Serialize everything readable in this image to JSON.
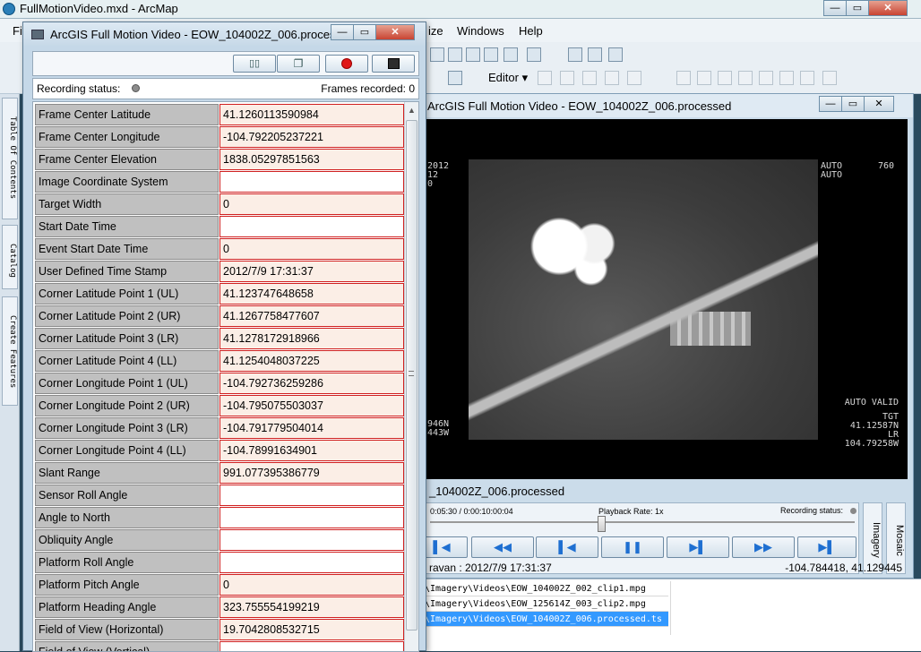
{
  "arcmap": {
    "title": "FullMotionVideo.mxd - ArcMap",
    "menu_partial": [
      "Fil",
      "ize",
      "Windows",
      "Help"
    ],
    "editor_label": "Editor",
    "left_tabs": [
      "Table Of Contents",
      "Catalog",
      "Create Features"
    ]
  },
  "video_window": {
    "title": "EOW_104002Z_006.processed",
    "title_visible": "ArcGIS Full Motion Video - EOW_104002Z_006.processed",
    "hud": {
      "top_left": [
        "2012",
        "12",
        "0"
      ],
      "top_tags": [
        "AUTO",
        "AUTO"
      ],
      "top_right_num": "760",
      "bottom_right": [
        "AUTO VALID",
        "TGT",
        "41.12587N",
        "LR 104.79258W"
      ],
      "bottom_left": [
        "946N",
        "443W"
      ]
    },
    "clip_title": "_104002Z_006.processed",
    "time": "0:05:30 / 0:00:10:00:04",
    "playback_rate": "Playback Rate: 1x",
    "recording_status": "Recording status:",
    "side_tabs": [
      "Imagery",
      "Mosaic"
    ],
    "status_left": "ravan : 2012/7/9 17:31:37",
    "status_right": "-104.784418, 41.129445",
    "files": [
      "\\Imagery\\Videos\\EOW_104002Z_002_clip1.mpg",
      "\\Imagery\\Videos\\EOW_125614Z_003_clip2.mpg",
      "\\Imagery\\Videos\\EOW_104002Z_006.processed.ts"
    ]
  },
  "dialog": {
    "title": "ArcGIS Full Motion Video - EOW_104002Z_006.proces...",
    "recording_label": "Recording status:",
    "frames_label": "Frames recorded: 0",
    "rows": [
      {
        "name": "Frame Center Latitude",
        "value": "41.1260113590984"
      },
      {
        "name": "Frame Center Longitude",
        "value": "-104.792205237221"
      },
      {
        "name": "Frame Center Elevation",
        "value": "1838.05297851563"
      },
      {
        "name": "Image Coordinate System",
        "value": ""
      },
      {
        "name": "Target Width",
        "value": "0"
      },
      {
        "name": "Start Date Time",
        "value": ""
      },
      {
        "name": "Event Start Date Time",
        "value": "0"
      },
      {
        "name": "User Defined Time Stamp",
        "value": "2012/7/9 17:31:37"
      },
      {
        "name": "Corner Latitude Point 1 (UL)",
        "value": "41.123747648658"
      },
      {
        "name": "Corner Latitude Point 2 (UR)",
        "value": "41.1267758477607"
      },
      {
        "name": "Corner Latitude Point 3 (LR)",
        "value": "41.1278172918966"
      },
      {
        "name": "Corner Latitude Point 4 (LL)",
        "value": "41.1254048037225"
      },
      {
        "name": "Corner Longitude Point 1 (UL)",
        "value": "-104.792736259286"
      },
      {
        "name": "Corner Longitude Point 2 (UR)",
        "value": "-104.795075503037"
      },
      {
        "name": "Corner Longitude Point 3 (LR)",
        "value": "-104.791779504014"
      },
      {
        "name": "Corner Longitude Point 4 (LL)",
        "value": "-104.78991634901"
      },
      {
        "name": "Slant Range",
        "value": "991.077395386779"
      },
      {
        "name": "Sensor Roll Angle",
        "value": ""
      },
      {
        "name": "Angle to North",
        "value": ""
      },
      {
        "name": "Obliquity Angle",
        "value": ""
      },
      {
        "name": "Platform Roll Angle",
        "value": ""
      },
      {
        "name": "Platform Pitch Angle",
        "value": "0"
      },
      {
        "name": "Platform Heading Angle",
        "value": "323.755554199219"
      },
      {
        "name": "Field of View (Horizontal)",
        "value": "19.7042808532715"
      },
      {
        "name": "Field of View (Vertical)",
        "value": ""
      }
    ]
  },
  "colors": {
    "value_border": "#d02020",
    "filled_value_bg": "#fbeee6",
    "name_bg": "#c0c0c0",
    "selection": "#3399ff"
  }
}
